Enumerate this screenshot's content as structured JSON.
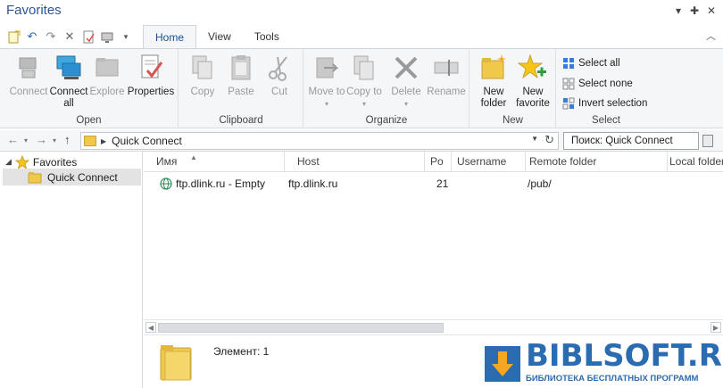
{
  "window": {
    "title": "Favorites"
  },
  "ribbon_tabs": [
    {
      "label": "Home",
      "active": true
    },
    {
      "label": "View",
      "active": false
    },
    {
      "label": "Tools",
      "active": false
    }
  ],
  "groups": {
    "open": {
      "label": "Open",
      "connect": "Connect",
      "connect_all": "Connect all",
      "explore": "Explore",
      "properties": "Properties"
    },
    "clipboard": {
      "label": "Clipboard",
      "copy": "Copy",
      "paste": "Paste",
      "cut": "Cut"
    },
    "organize": {
      "label": "Organize",
      "move_to": "Move to",
      "copy_to": "Copy to",
      "delete": "Delete",
      "rename": "Rename"
    },
    "new": {
      "label": "New",
      "new_folder": "New folder",
      "new_favorite": "New favorite"
    },
    "select": {
      "label": "Select",
      "select_all": "Select all",
      "select_none": "Select none",
      "invert_selection": "Invert selection"
    }
  },
  "address": {
    "path": "Quick Connect"
  },
  "search": {
    "value": "Поиск: Quick Connect"
  },
  "tree": {
    "root": "Favorites",
    "child": "Quick Connect"
  },
  "columns": [
    "Имя",
    "Host",
    "Po",
    "Username",
    "Remote folder",
    "Local folder"
  ],
  "rows": [
    {
      "name": "ftp.dlink.ru - Empty",
      "host": "ftp.dlink.ru",
      "port": "21",
      "username": "",
      "remote": "/pub/",
      "local": ""
    }
  ],
  "status": {
    "items": "Элемент: 1"
  },
  "watermark": {
    "brand": "BIBLSOFT.RU",
    "sub": "БИБЛИОТЕКА БЕСПЛАТНЫХ ПРОГРАММ"
  },
  "colors": {
    "accent": "#2b5797",
    "watermark": "#2b6cb0",
    "folder": "#f0c84a"
  }
}
